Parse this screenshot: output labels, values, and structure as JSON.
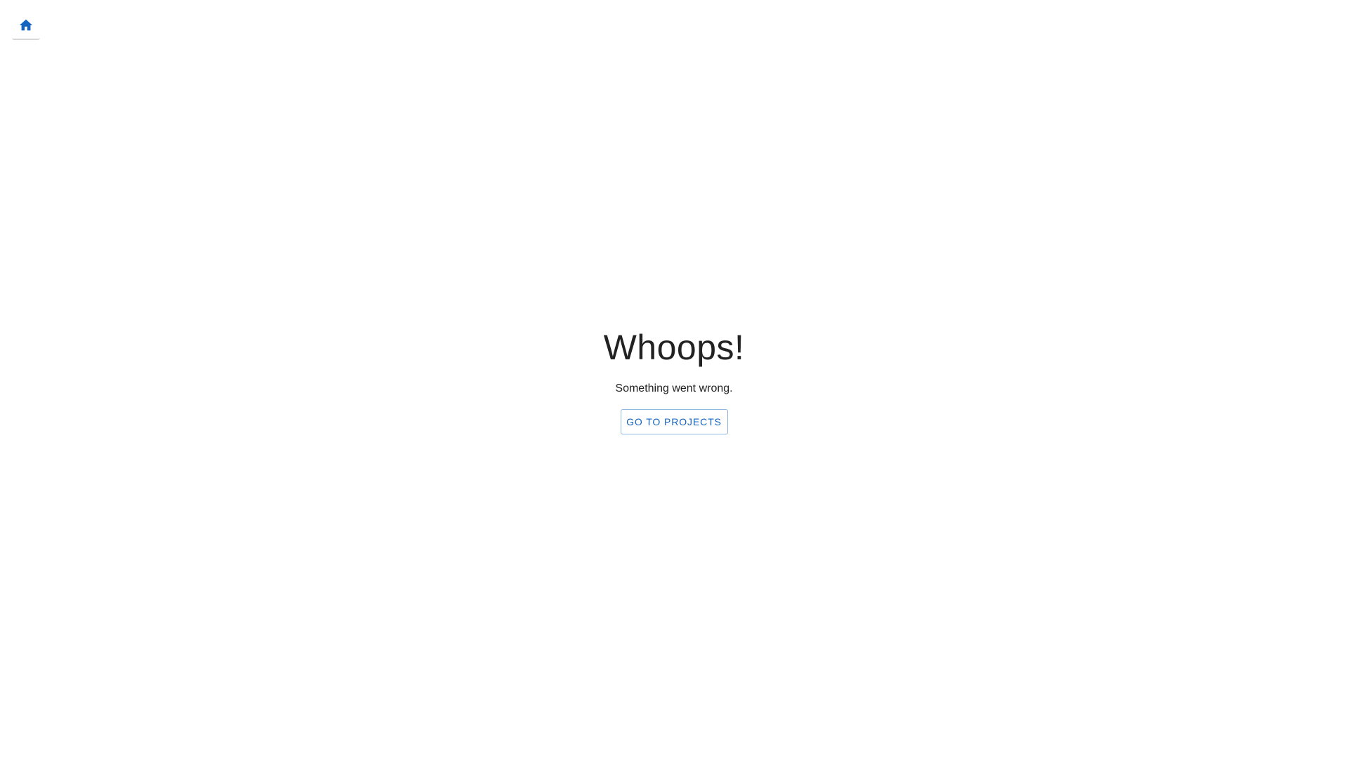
{
  "nav": {
    "home_icon": "home-icon",
    "accent_color": "#1565c0"
  },
  "error": {
    "title": "Whoops!",
    "message": "Something went wrong.",
    "button_label": "GO TO PROJECTS"
  }
}
